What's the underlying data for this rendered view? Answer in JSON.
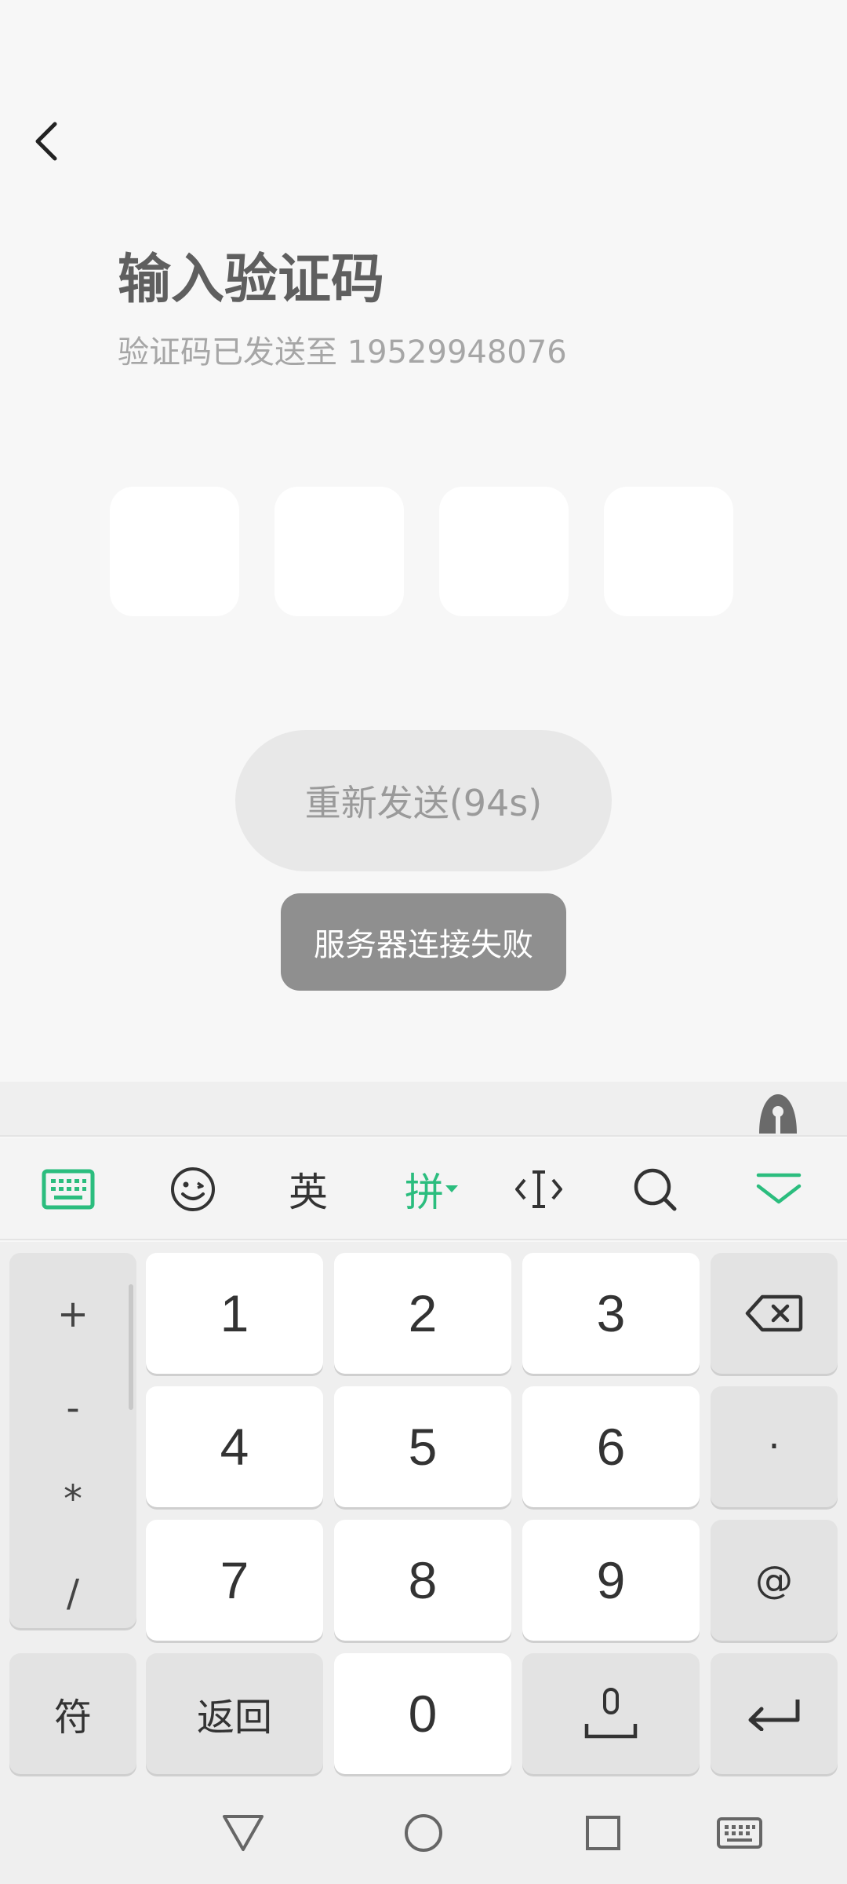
{
  "header": {
    "title": "输入验证码",
    "subtitle": "验证码已发送至 19529948076"
  },
  "code_inputs": [
    "",
    "",
    "",
    ""
  ],
  "resend": {
    "label": "重新发送(94s)"
  },
  "toast": {
    "text": "服务器连接失败"
  },
  "keyboard": {
    "toolbar": {
      "english": "英",
      "pinyin": "拼"
    },
    "symbols": [
      "+",
      "-",
      "*",
      "/"
    ],
    "digits": [
      "1",
      "2",
      "3",
      "4",
      "5",
      "6",
      "7",
      "8",
      "9",
      "0"
    ],
    "dot": "·",
    "at": "@",
    "fu": "符",
    "back": "返回"
  },
  "colors": {
    "accent": "#2bbd7e",
    "background": "#f7f7f7",
    "toast_bg": "#8f8f8f"
  }
}
